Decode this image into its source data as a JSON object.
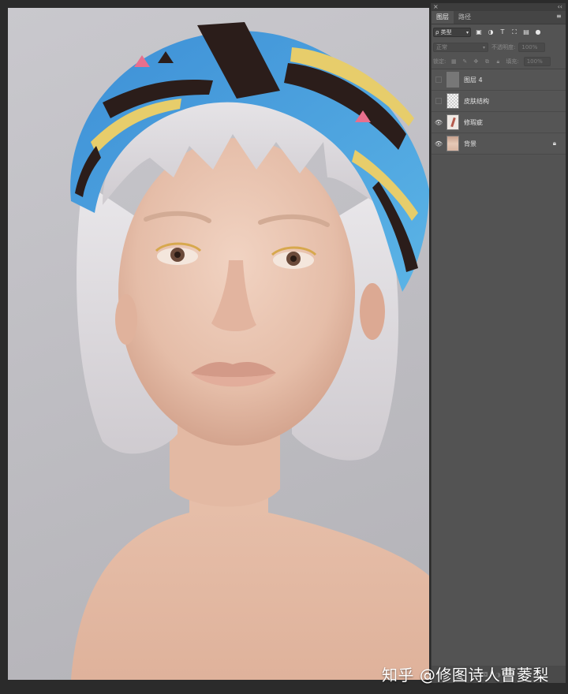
{
  "panel": {
    "close_glyph": "×",
    "collapse_glyph": "‹‹",
    "tabs": [
      {
        "label": "图层",
        "active": true
      },
      {
        "label": "路径",
        "active": false
      }
    ],
    "menu_glyph": "≡",
    "filter": {
      "kind_label": "ρ 类型",
      "icons": [
        "image-filter-icon",
        "adjustment-filter-icon",
        "type-filter-icon",
        "shape-filter-icon",
        "smart-object-filter-icon",
        "filter-toggle-icon"
      ]
    },
    "blend_mode": "正常",
    "opacity_label": "不透明度:",
    "opacity_value": "100%",
    "lock_label": "锁定:",
    "fill_label": "填充:",
    "fill_value": "100%",
    "layers": [
      {
        "name": "图层 4",
        "visible": false,
        "thumb": "gray",
        "locked": false
      },
      {
        "name": "皮肤结构",
        "visible": false,
        "thumb": "checker",
        "locked": false
      },
      {
        "name": "修瑕疵",
        "visible": true,
        "thumb": "retouch",
        "locked": false
      },
      {
        "name": "背景",
        "visible": true,
        "thumb": "photo",
        "locked": true
      }
    ]
  },
  "watermark": "知乎 @修图诗人曹菱梨",
  "colors": {
    "panel_bg": "#535353",
    "app_bg": "#2b2b2b",
    "backdrop": "#c4c3c8"
  }
}
